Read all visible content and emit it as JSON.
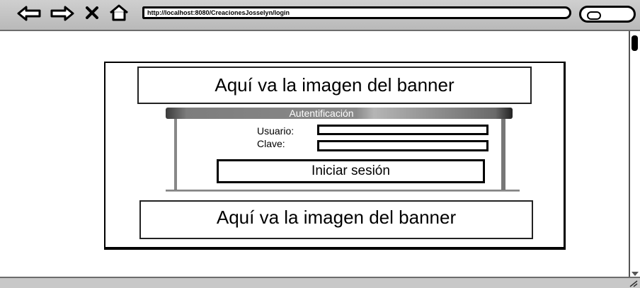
{
  "browser": {
    "url": "http://localhost:8080/CreacionesJosselyn/login",
    "nav_icons": [
      "back-arrow-icon",
      "forward-arrow-icon",
      "stop-x-icon",
      "home-icon"
    ],
    "search_icon": "search-icon"
  },
  "page": {
    "banner_top": "Aquí va la imagen del banner",
    "banner_bottom": "Aquí va la imagen del banner",
    "auth": {
      "title": "Autentificación",
      "username_label": "Usuario:",
      "username_value": "",
      "password_label": "Clave:",
      "password_value": "",
      "login_button": "Iniciar sesión"
    }
  }
}
